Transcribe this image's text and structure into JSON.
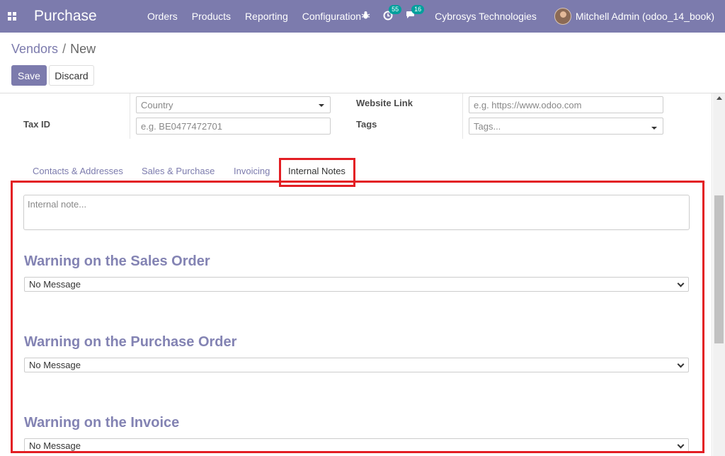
{
  "navbar": {
    "app_title": "Purchase",
    "menu": [
      "Orders",
      "Products",
      "Reporting",
      "Configuration"
    ],
    "activity_count": "55",
    "message_count": "16",
    "company": "Cybrosys Technologies",
    "user": "Mitchell Admin (odoo_14_book)"
  },
  "breadcrumb": {
    "parent": "Vendors",
    "separator": "/",
    "current": "New"
  },
  "buttons": {
    "save": "Save",
    "discard": "Discard"
  },
  "form": {
    "country_placeholder": "Country",
    "tax_id_label": "Tax ID",
    "tax_id_placeholder": "e.g. BE0477472701",
    "website_label": "Website Link",
    "website_placeholder": "e.g. https://www.odoo.com",
    "tags_label": "Tags",
    "tags_placeholder": "Tags..."
  },
  "tabs": [
    "Contacts & Addresses",
    "Sales & Purchase",
    "Invoicing",
    "Internal Notes"
  ],
  "active_tab": "Internal Notes",
  "internal_notes": {
    "note_placeholder": "Internal note...",
    "sales_warning_title": "Warning on the Sales Order",
    "sales_warning_value": "No Message",
    "purchase_warning_title": "Warning on the Purchase Order",
    "purchase_warning_value": "No Message",
    "invoice_warning_title": "Warning on the Invoice",
    "invoice_warning_value": "No Message"
  },
  "colors": {
    "brand": "#7c7bad",
    "highlight": "#e31e24",
    "section_title": "#8383b3",
    "badge": "#00a09d"
  }
}
